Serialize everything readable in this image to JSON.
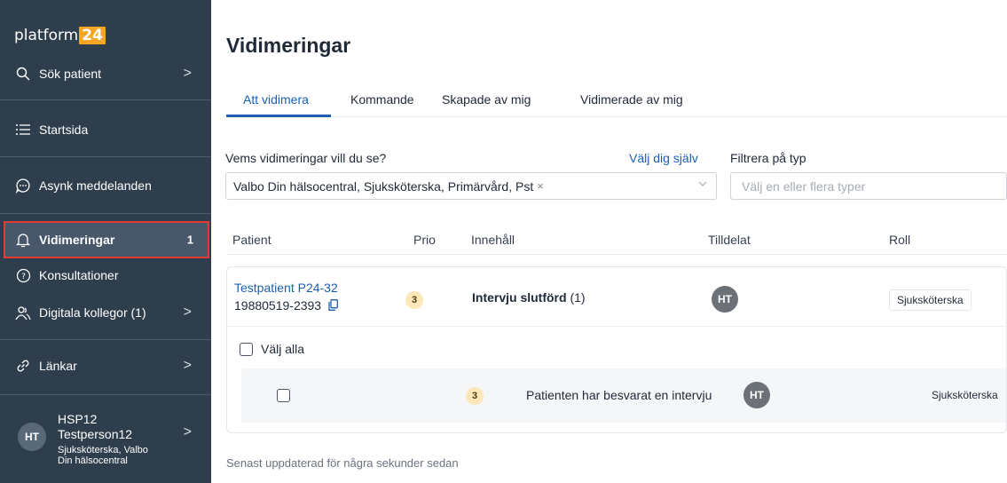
{
  "app": {
    "logo_text": "platform",
    "logo_num": "24"
  },
  "sidebar": {
    "items": [
      {
        "label": "Sök patient",
        "icon": "search-icon"
      },
      {
        "label": "Startsida",
        "icon": "list-icon"
      },
      {
        "label": "Asynk meddelanden",
        "icon": "chat-icon"
      },
      {
        "label": "Vidimeringar",
        "icon": "bell-icon",
        "badge": "1"
      },
      {
        "label": "Konsultationer",
        "icon": "question-icon"
      },
      {
        "label": "Digitala kollegor (1)",
        "icon": "people-icon"
      },
      {
        "label": "Länkar",
        "icon": "link-icon"
      }
    ],
    "user": {
      "initials": "HT",
      "line1": "HSP12",
      "line2": "Testperson12",
      "role": "Sjuksköterska, Valbo Din hälsocentral"
    }
  },
  "main": {
    "title": "Vidimeringar",
    "tabs": [
      "Att vidimera",
      "Kommande",
      "Skapade av mig",
      "Vidimerade av mig"
    ],
    "filters": {
      "whose_label": "Vems vidimeringar vill du se?",
      "choose_self": "Välj dig själv",
      "whose_value": "Valbo Din hälsocentral, Sjuksköterska, Primärvård, Pst",
      "type_label": "Filtrera på typ",
      "type_placeholder": "Välj en eller flera typer"
    },
    "columns": [
      "Patient",
      "Prio",
      "Innehåll",
      "Tilldelat",
      "Roll"
    ],
    "row": {
      "patient_name": "Testpatient P24-32",
      "patient_id": "19880519-2393",
      "prio": "3",
      "content_bold": "Intervju slutförd",
      "content_count": "(1)",
      "assignee": "HT",
      "role": "Sjuksköterska"
    },
    "select_all": "Välj alla",
    "sub_row": {
      "prio": "3",
      "content": "Patienten har besvarat en intervju",
      "assignee": "HT",
      "role": "Sjuksköterska"
    },
    "updated": "Senast uppdaterad för några sekunder sedan"
  },
  "colors": {
    "accent": "#1a5fb4",
    "sidebar": "#2f3e4c",
    "highlight": "#e53935",
    "prio_bg": "#fde7b8"
  }
}
